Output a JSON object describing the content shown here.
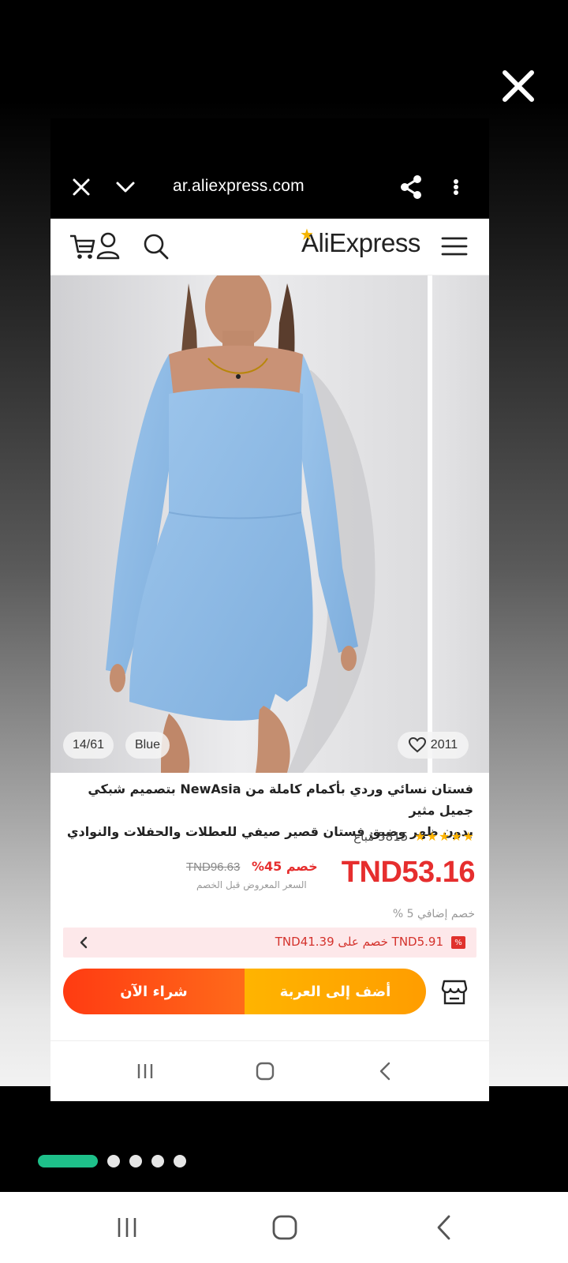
{
  "browser": {
    "url": "ar.aliexpress.com"
  },
  "site": {
    "logo_text": "AliExpress"
  },
  "gallery": {
    "image_counter": "14/61",
    "color_label": "Blue",
    "wishlist_count": "2011",
    "image_description_icon": "product-photo"
  },
  "product": {
    "title_line1": "فستان نسائي وردي بأكمام كاملة من NewAsia بتصميم شبكي جميل مثير",
    "title_line2": "بدون ظهر وضيق فستان قصير صيفي للعطلات والحفلات والنوادي",
    "stars": "★★★★★",
    "sold": "5815 مُباع",
    "price": "TND53.16",
    "discount": "خصم 45%",
    "old_price": "TND96.63",
    "price_note": "السعر المعروض قبل الخصم",
    "extra_discount": "خصم إضافي 5 %",
    "coupon_text": "TND5.91 خصم على TND41.39",
    "coupon_badge": "%"
  },
  "actions": {
    "buy_now": "شراء الآن",
    "add_to_cart": "أضف إلى العربة"
  },
  "pager": {
    "total_dots": 5,
    "active_index": 0
  },
  "colors": {
    "price_red": "#e62e2e",
    "buy_orange": "#ff3b12",
    "cart_yellow": "#ffb400",
    "pager_green": "#1ec08a"
  }
}
